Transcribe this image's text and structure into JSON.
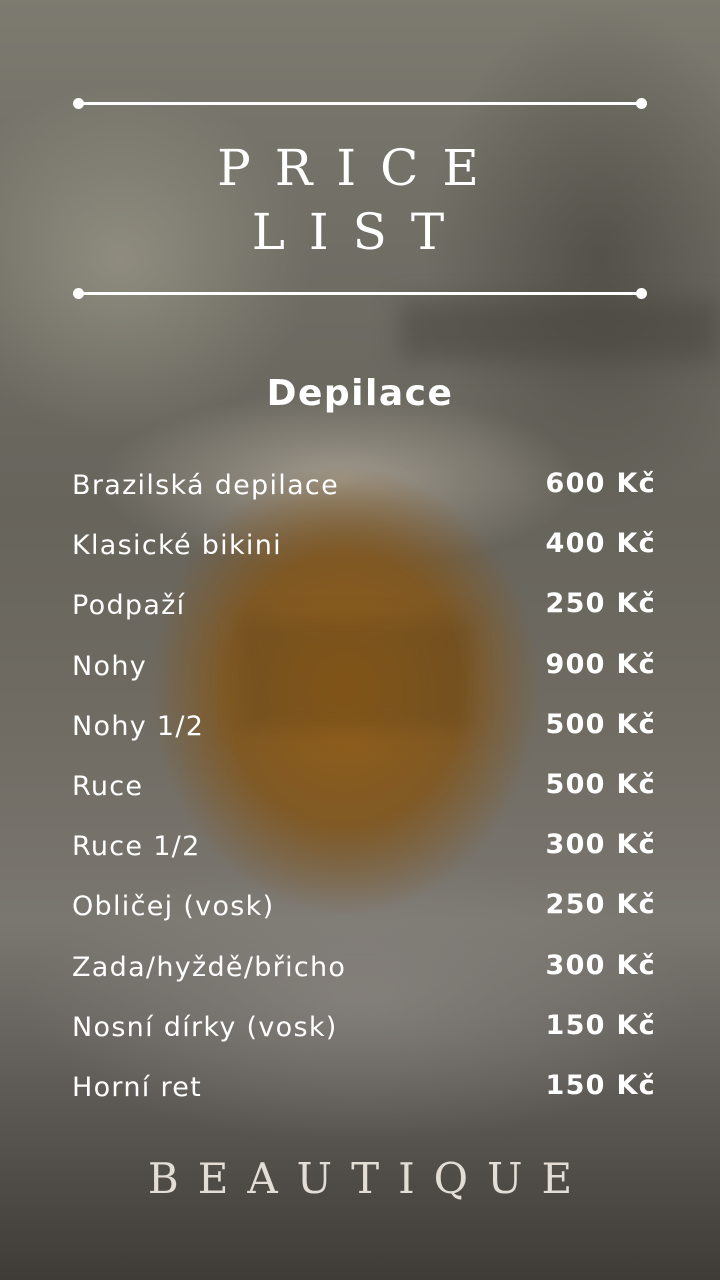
{
  "header": {
    "title_line1": "PRICE",
    "title_line2": "LIST"
  },
  "section_title": "Depilace",
  "items": [
    {
      "name": "Brazilská depilace",
      "price": "600 Kč"
    },
    {
      "name": "Klasické bikini",
      "price": "400 Kč"
    },
    {
      "name": "Podpaží",
      "price": "250 Kč"
    },
    {
      "name": "Nohy",
      "price": "900 Kč"
    },
    {
      "name": "Nohy 1/2",
      "price": "500 Kč"
    },
    {
      "name": "Ruce",
      "price": "500 Kč"
    },
    {
      "name": "Ruce 1/2",
      "price": "300 Kč"
    },
    {
      "name": "Obličej (vosk)",
      "price": "250 Kč"
    },
    {
      "name": "Zada/hyždě/břicho",
      "price": "300 Kč"
    },
    {
      "name": "Nosní dírky (vosk)",
      "price": "150 Kč"
    },
    {
      "name": "Horní ret",
      "price": "150 Kč"
    }
  ],
  "brand": "BEAUTIQUE",
  "colors": {
    "text": "#ffffff",
    "brand_text": "#e3ddd6",
    "jar_accent": "#965f14"
  }
}
